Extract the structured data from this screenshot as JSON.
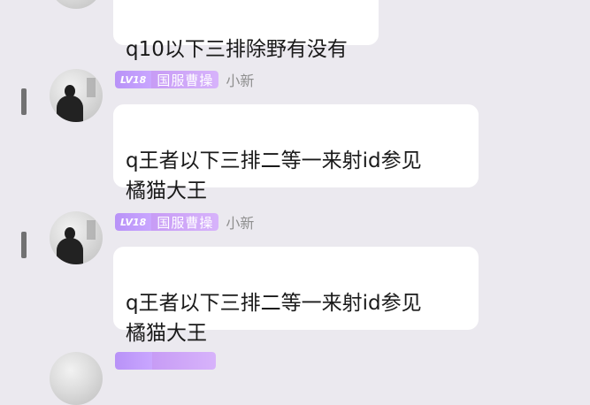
{
  "messages": [
    {
      "text": "q10以下三排除野有没有"
    },
    {
      "level": "LV18",
      "title": "国服曹操",
      "username": "小新",
      "text": "q王者以下三排二等一来射id参见\n橘猫大王"
    },
    {
      "level": "LV18",
      "title": "国服曹操",
      "username": "小新",
      "text": "q王者以下三排二等一来射id参见\n橘猫大王"
    }
  ]
}
